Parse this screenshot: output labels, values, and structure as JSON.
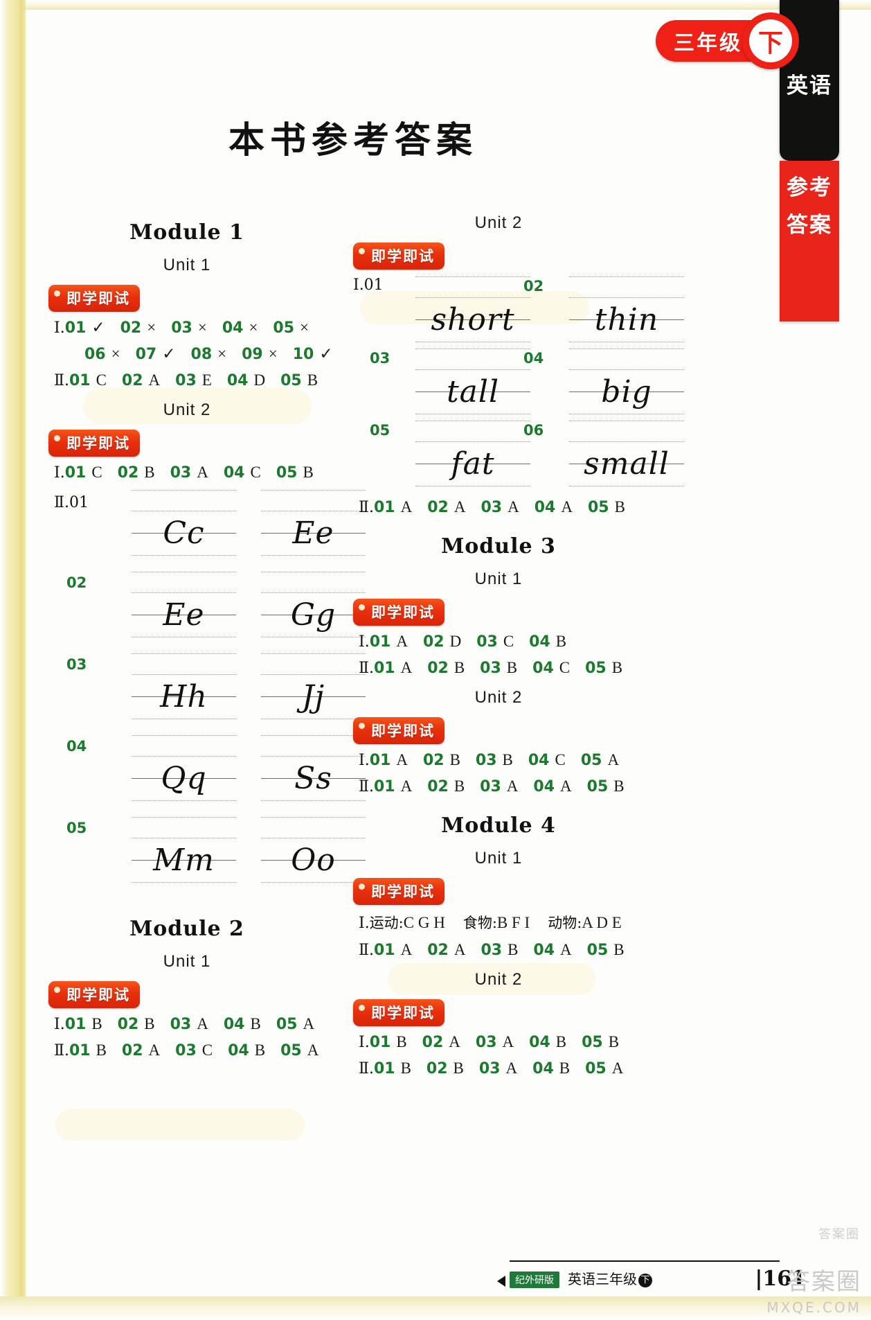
{
  "page": {
    "title": "本书参考答案",
    "page_number": "161",
    "footer_text": "英语三年级",
    "footer_volume": "下",
    "footer_badge": "纪外研版",
    "watermark_cn": "答案圈",
    "watermark_url": "MXQE.COM",
    "watermark_top": "答案圈"
  },
  "side_tab": {
    "grade": "三年级",
    "volume": "下",
    "subject": "英语",
    "section": "参考答案"
  },
  "badge_label": "即学即试",
  "labels": {
    "roman1": "Ⅰ",
    "roman2": "Ⅱ",
    "dot": "."
  },
  "left_column": [
    {
      "type": "module",
      "title": "Module 1"
    },
    {
      "type": "unit",
      "title": "Unit 1"
    },
    {
      "type": "badge"
    },
    {
      "type": "answers",
      "prefix": "Ⅰ.",
      "items": [
        {
          "n": "01",
          "v": "✓"
        },
        {
          "n": "02",
          "v": "×"
        },
        {
          "n": "03",
          "v": "×"
        },
        {
          "n": "04",
          "v": "×"
        },
        {
          "n": "05",
          "v": "×"
        }
      ]
    },
    {
      "type": "answers",
      "prefix": "",
      "items": [
        {
          "n": "06",
          "v": "×"
        },
        {
          "n": "07",
          "v": "✓"
        },
        {
          "n": "08",
          "v": "×"
        },
        {
          "n": "09",
          "v": "×"
        },
        {
          "n": "10",
          "v": "✓"
        }
      ]
    },
    {
      "type": "answers",
      "prefix": "Ⅱ.",
      "items": [
        {
          "n": "01",
          "v": "C"
        },
        {
          "n": "02",
          "v": "A"
        },
        {
          "n": "03",
          "v": "E"
        },
        {
          "n": "04",
          "v": "D"
        },
        {
          "n": "05",
          "v": "B"
        }
      ]
    },
    {
      "type": "unit",
      "title": "Unit 2"
    },
    {
      "type": "badge"
    },
    {
      "type": "answers",
      "prefix": "Ⅰ.",
      "items": [
        {
          "n": "01",
          "v": "C"
        },
        {
          "n": "02",
          "v": "B"
        },
        {
          "n": "03",
          "v": "A"
        },
        {
          "n": "04",
          "v": "C"
        },
        {
          "n": "05",
          "v": "B"
        }
      ]
    },
    {
      "type": "writing_pairs",
      "prefix": "Ⅱ.",
      "rows": [
        {
          "n": "01",
          "left": "Cc",
          "right": "Ee"
        },
        {
          "n": "02",
          "left": "Ee",
          "right": "Gg"
        },
        {
          "n": "03",
          "left": "Hh",
          "right": "Jj"
        },
        {
          "n": "04",
          "left": "Qq",
          "right": "Ss"
        },
        {
          "n": "05",
          "left": "Mm",
          "right": "Oo"
        }
      ]
    },
    {
      "type": "module",
      "title": "Module 2"
    },
    {
      "type": "unit",
      "title": "Unit 1"
    },
    {
      "type": "badge"
    },
    {
      "type": "answers",
      "prefix": "Ⅰ.",
      "items": [
        {
          "n": "01",
          "v": "B"
        },
        {
          "n": "02",
          "v": "B"
        },
        {
          "n": "03",
          "v": "A"
        },
        {
          "n": "04",
          "v": "B"
        },
        {
          "n": "05",
          "v": "A"
        }
      ]
    },
    {
      "type": "answers",
      "prefix": "Ⅱ.",
      "items": [
        {
          "n": "01",
          "v": "B"
        },
        {
          "n": "02",
          "v": "A"
        },
        {
          "n": "03",
          "v": "C"
        },
        {
          "n": "04",
          "v": "B"
        },
        {
          "n": "05",
          "v": "A"
        }
      ]
    }
  ],
  "right_column": [
    {
      "type": "unit",
      "title": "Unit 2"
    },
    {
      "type": "badge"
    },
    {
      "type": "writing_words",
      "prefix": "Ⅰ.",
      "rows": [
        {
          "n1": "01",
          "w1": "short",
          "n2": "02",
          "w2": "thin"
        },
        {
          "n1": "03",
          "w1": "tall",
          "n2": "04",
          "w2": "big"
        },
        {
          "n1": "05",
          "w1": "fat",
          "n2": "06",
          "w2": "small"
        }
      ]
    },
    {
      "type": "answers",
      "prefix": "Ⅱ.",
      "items": [
        {
          "n": "01",
          "v": "A"
        },
        {
          "n": "02",
          "v": "A"
        },
        {
          "n": "03",
          "v": "A"
        },
        {
          "n": "04",
          "v": "A"
        },
        {
          "n": "05",
          "v": "B"
        }
      ]
    },
    {
      "type": "module",
      "title": "Module 3"
    },
    {
      "type": "unit",
      "title": "Unit 1"
    },
    {
      "type": "badge"
    },
    {
      "type": "answers",
      "prefix": "Ⅰ.",
      "items": [
        {
          "n": "01",
          "v": "A"
        },
        {
          "n": "02",
          "v": "D"
        },
        {
          "n": "03",
          "v": "C"
        },
        {
          "n": "04",
          "v": "B"
        }
      ]
    },
    {
      "type": "answers",
      "prefix": "Ⅱ.",
      "items": [
        {
          "n": "01",
          "v": "A"
        },
        {
          "n": "02",
          "v": "B"
        },
        {
          "n": "03",
          "v": "B"
        },
        {
          "n": "04",
          "v": "C"
        },
        {
          "n": "05",
          "v": "B"
        }
      ]
    },
    {
      "type": "unit",
      "title": "Unit 2"
    },
    {
      "type": "badge"
    },
    {
      "type": "answers",
      "prefix": "Ⅰ.",
      "items": [
        {
          "n": "01",
          "v": "A"
        },
        {
          "n": "02",
          "v": "B"
        },
        {
          "n": "03",
          "v": "B"
        },
        {
          "n": "04",
          "v": "C"
        },
        {
          "n": "05",
          "v": "A"
        }
      ]
    },
    {
      "type": "answers",
      "prefix": "Ⅱ.",
      "items": [
        {
          "n": "01",
          "v": "A"
        },
        {
          "n": "02",
          "v": "B"
        },
        {
          "n": "03",
          "v": "A"
        },
        {
          "n": "04",
          "v": "A"
        },
        {
          "n": "05",
          "v": "B"
        }
      ]
    },
    {
      "type": "module",
      "title": "Module 4"
    },
    {
      "type": "unit",
      "title": "Unit 1"
    },
    {
      "type": "badge"
    },
    {
      "type": "category_answer",
      "prefix": "Ⅰ.",
      "groups": [
        {
          "label": "运动:",
          "value": "C G H"
        },
        {
          "label": "食物:",
          "value": "B F I"
        },
        {
          "label": "动物:",
          "value": "A D E"
        }
      ]
    },
    {
      "type": "answers",
      "prefix": "Ⅱ.",
      "items": [
        {
          "n": "01",
          "v": "A"
        },
        {
          "n": "02",
          "v": "A"
        },
        {
          "n": "03",
          "v": "B"
        },
        {
          "n": "04",
          "v": "A"
        },
        {
          "n": "05",
          "v": "B"
        }
      ]
    },
    {
      "type": "unit",
      "title": "Unit 2"
    },
    {
      "type": "badge"
    },
    {
      "type": "answers",
      "prefix": "Ⅰ.",
      "items": [
        {
          "n": "01",
          "v": "B"
        },
        {
          "n": "02",
          "v": "A"
        },
        {
          "n": "03",
          "v": "A"
        },
        {
          "n": "04",
          "v": "B"
        },
        {
          "n": "05",
          "v": "B"
        }
      ]
    },
    {
      "type": "answers",
      "prefix": "Ⅱ.",
      "items": [
        {
          "n": "01",
          "v": "B"
        },
        {
          "n": "02",
          "v": "B"
        },
        {
          "n": "03",
          "v": "A"
        },
        {
          "n": "04",
          "v": "B"
        },
        {
          "n": "05",
          "v": "A"
        }
      ]
    }
  ],
  "colors": {
    "accent_red": "#ef2016",
    "badge_orange": "#e8300c",
    "answer_green": "#1b7a2e",
    "ink": "#111111"
  }
}
